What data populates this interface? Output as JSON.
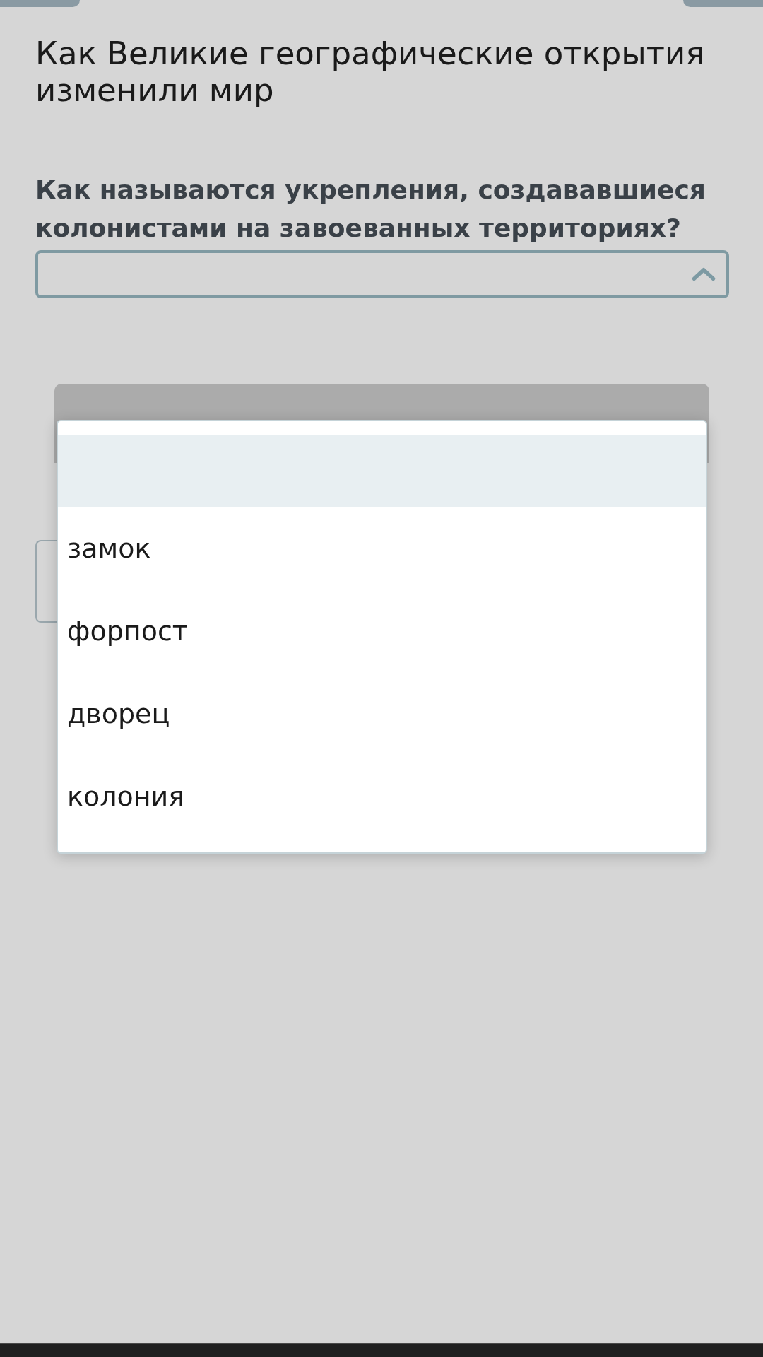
{
  "page_title": "Как Великие географические открытия изменили мир",
  "question": "Как называются укрепления, создававшиеся колонистами на завоеванных территориях?",
  "select": {
    "expanded": true
  },
  "dropdown_options": [
    {
      "selected": true
    },
    {
      "label": "замок",
      "selected": false
    },
    {
      "label": "форпост",
      "selected": false
    },
    {
      "label": "дворец",
      "selected": false
    },
    {
      "label": "колония",
      "selected": false
    }
  ]
}
